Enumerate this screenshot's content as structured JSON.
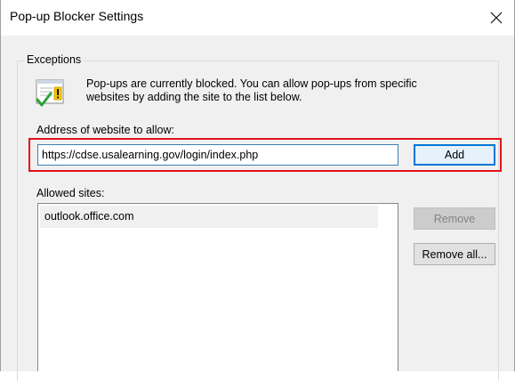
{
  "window": {
    "title": "Pop-up Blocker Settings",
    "close_icon": "close-icon"
  },
  "exceptions": {
    "legend": "Exceptions",
    "icon": "popup-blocker-info-icon",
    "info_line1": "Pop-ups are currently blocked.  You can allow pop-ups from specific",
    "info_line2": "websites by adding the site to the list below.",
    "address_label": "Address of website to allow:",
    "address_value": "https://cdse.usalearning.gov/login/index.php",
    "add_label": "Add",
    "allowed_label": "Allowed sites:",
    "allowed_sites": [
      "outlook.office.com"
    ],
    "remove_label": "Remove",
    "remove_all_label": "Remove all..."
  },
  "colors": {
    "highlight_box": "#e3121b",
    "focus_blue": "#0078d7",
    "check_green": "#2e9f3a",
    "warning_yellow": "#f5c400"
  }
}
